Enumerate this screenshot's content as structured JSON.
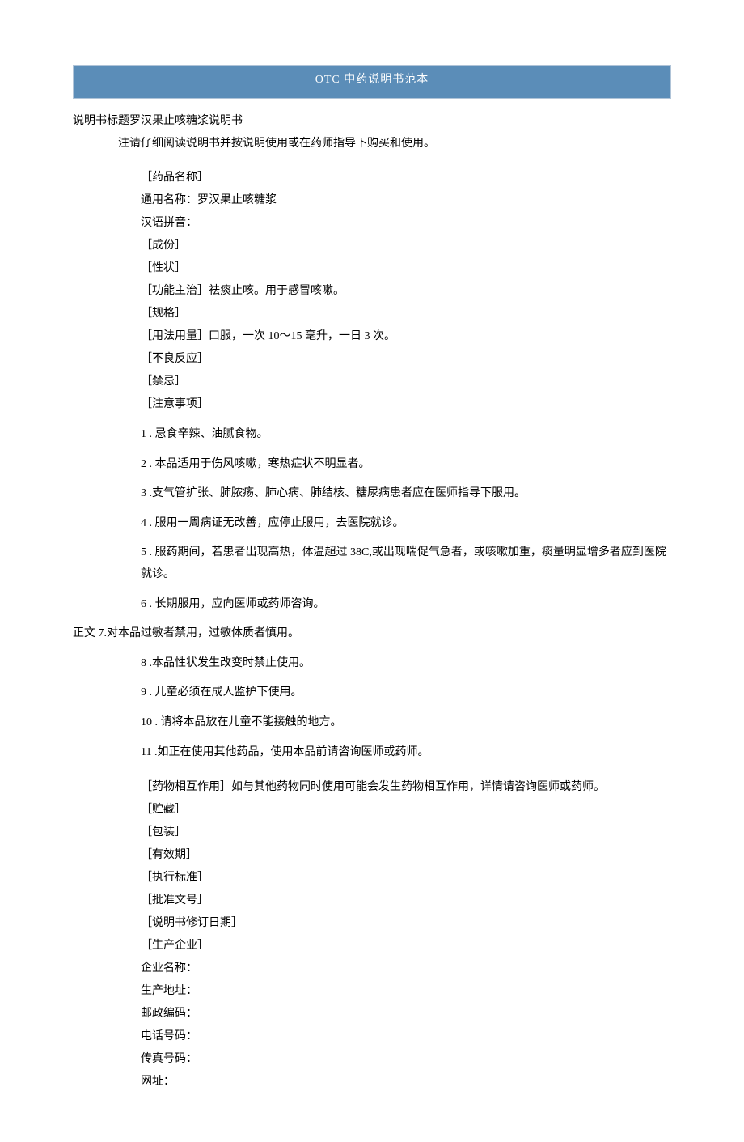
{
  "banner": "OTC 中药说明书范本",
  "titleLine": "说明书标题罗汉果止咳糖浆说明书",
  "noticeLine": "注请仔细阅读说明书并按说明使用或在药师指导下购买和使用。",
  "section1": [
    "［药品名称］",
    "通用名称：罗汉果止咳糖浆",
    "汉语拼音：",
    "［成份］",
    "［性状］",
    "［功能主治］祛痰止咳。用于感冒咳嗽。",
    "［规格］",
    "［用法用量］口服，一次 10～15 毫升，一日 3 次。",
    "［不良反应］",
    "［禁忌］",
    "［注意事项］"
  ],
  "notes": [
    "1  . 忌食辛辣、油腻食物。",
    "2  . 本品适用于伤风咳嗽，寒热症状不明显者。",
    "3  .支气管扩张、肺脓疡、肺心病、肺结核、糖尿病患者应在医师指导下服用。",
    "4  . 服用一周病证无改善，应停止服用，去医院就诊。",
    "5  . 服药期间，若患者出现高热，体温超过 38C,或出现喘促气急者，或咳嗽加重，痰量明显增多者应到医院就诊。",
    "6  . 长期服用，应向医师或药师咨询。"
  ],
  "bodyLabelLine": "正文 7.对本品过敏者禁用，过敏体质者慎用。",
  "notes2": [
    "8  .本品性状发生改变时禁止使用。",
    "9  . 儿童必须在成人监护下使用。",
    "10  . 请将本品放在儿童不能接触的地方。",
    "11  .如正在使用其他药品，使用本品前请咨询医师或药师。"
  ],
  "section2": [
    "［药物相互作用］如与其他药物同时使用可能会发生药物相互作用，详情请咨询医师或药师。",
    "［贮藏］",
    "［包装］",
    "［有效期］",
    "［执行标准］",
    "［批准文号］",
    "［说明书修订日期］",
    "［生产企业］",
    "企业名称：",
    "生产地址：",
    "邮政编码：",
    "电话号码：",
    "传真号码：",
    "网址："
  ]
}
